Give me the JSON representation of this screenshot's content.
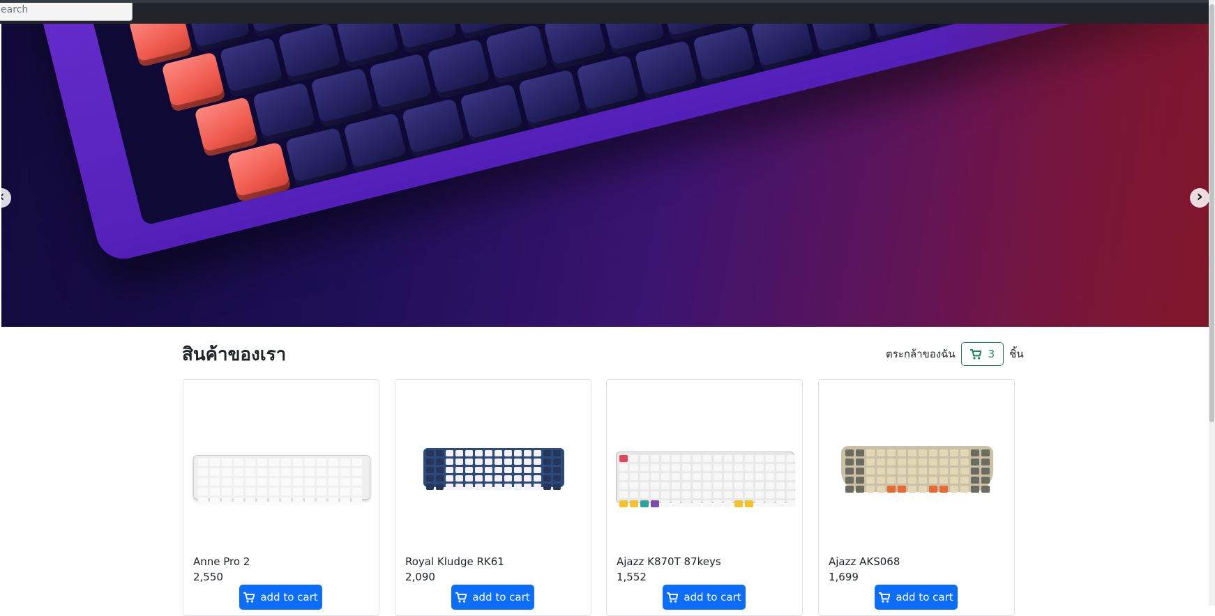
{
  "search": {
    "placeholder": "Search",
    "value": "earch"
  },
  "hero": {
    "alt": "mechanical keyboard banner"
  },
  "section": {
    "title": "สินค้าของเรา"
  },
  "cart": {
    "label": "ตระกล้าของฉัน",
    "count": "3",
    "unit": "ชิ้น"
  },
  "products": [
    {
      "name": "Anne Pro 2",
      "price": "2,550",
      "button": "add to cart"
    },
    {
      "name": "Royal Kludge RK61",
      "price": "2,090",
      "button": "add to cart"
    },
    {
      "name": "Ajazz K870T 87keys",
      "price": "1,552",
      "button": "add to cart"
    },
    {
      "name": "Ajazz AKS068",
      "price": "1,699",
      "button": "add to cart"
    }
  ],
  "colors": {
    "primary": "#0d6efd",
    "success": "#198754",
    "topbar": "#212529"
  },
  "icons": {
    "cart": "cart-icon",
    "next": "chevron-right-icon",
    "prev": "chevron-left-icon"
  }
}
